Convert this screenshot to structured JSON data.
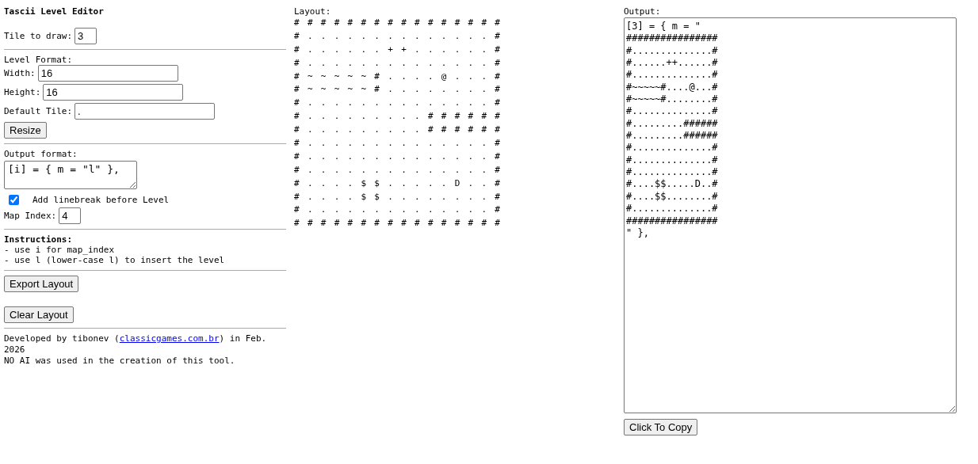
{
  "title": "Tascii Level Editor",
  "tile_to_draw": {
    "label": "Tile to draw:",
    "value": "3"
  },
  "level_format": {
    "heading": "Level Format:",
    "width": {
      "label": "Width:",
      "value": "16"
    },
    "height": {
      "label": "Height:",
      "value": "16"
    },
    "default_tile": {
      "label": "Default Tile:",
      "value": "."
    },
    "button": "Resize"
  },
  "output_format": {
    "heading": "Output format:",
    "value": "[i] = { m = \"l\" },",
    "linebreak": {
      "label": "Add linebreak before Level",
      "checked": true
    },
    "map_index": {
      "label": "Map Index:",
      "value": "4"
    }
  },
  "instructions": {
    "heading": "Instructions:",
    "lines": [
      "- use i for map_index",
      "- use l (lower-case l) to insert the level"
    ]
  },
  "buttons": [
    "Export Layout",
    "Clear Layout"
  ],
  "footer": {
    "before": "Developed by tibonev (",
    "link": "classicgames.com.br",
    "after": ") in Feb. 2026",
    "note": "NO AI was used in the creation of this tool."
  },
  "layout": {
    "label": "Layout:",
    "rows": [
      [
        "#",
        "#",
        "#",
        "#",
        "#",
        "#",
        "#",
        "#",
        "#",
        "#",
        "#",
        "#",
        "#",
        "#",
        "#",
        "#"
      ],
      [
        "#",
        ".",
        ".",
        ".",
        ".",
        ".",
        ".",
        ".",
        ".",
        ".",
        ".",
        ".",
        ".",
        ".",
        ".",
        "#"
      ],
      [
        "#",
        ".",
        ".",
        ".",
        ".",
        ".",
        ".",
        "+",
        "+",
        ".",
        ".",
        ".",
        ".",
        ".",
        ".",
        "#"
      ],
      [
        "#",
        ".",
        ".",
        ".",
        ".",
        ".",
        ".",
        ".",
        ".",
        ".",
        ".",
        ".",
        ".",
        ".",
        ".",
        "#"
      ],
      [
        "#",
        "~",
        "~",
        "~",
        "~",
        "~",
        "#",
        ".",
        ".",
        ".",
        ".",
        "@",
        ".",
        ".",
        ".",
        "#"
      ],
      [
        "#",
        "~",
        "~",
        "~",
        "~",
        "~",
        "#",
        ".",
        ".",
        ".",
        ".",
        ".",
        ".",
        ".",
        ".",
        "#"
      ],
      [
        "#",
        ".",
        ".",
        ".",
        ".",
        ".",
        ".",
        ".",
        ".",
        ".",
        ".",
        ".",
        ".",
        ".",
        ".",
        "#"
      ],
      [
        "#",
        ".",
        ".",
        ".",
        ".",
        ".",
        ".",
        ".",
        ".",
        ".",
        "#",
        "#",
        "#",
        "#",
        "#",
        "#"
      ],
      [
        "#",
        ".",
        ".",
        ".",
        ".",
        ".",
        ".",
        ".",
        ".",
        ".",
        "#",
        "#",
        "#",
        "#",
        "#",
        "#"
      ],
      [
        "#",
        ".",
        ".",
        ".",
        ".",
        ".",
        ".",
        ".",
        ".",
        ".",
        ".",
        ".",
        ".",
        ".",
        ".",
        "#"
      ],
      [
        "#",
        ".",
        ".",
        ".",
        ".",
        ".",
        ".",
        ".",
        ".",
        ".",
        ".",
        ".",
        ".",
        ".",
        ".",
        "#"
      ],
      [
        "#",
        ".",
        ".",
        ".",
        ".",
        ".",
        ".",
        ".",
        ".",
        ".",
        ".",
        ".",
        ".",
        ".",
        ".",
        "#"
      ],
      [
        "#",
        ".",
        ".",
        ".",
        ".",
        "$",
        "$",
        ".",
        ".",
        ".",
        ".",
        ".",
        "D",
        ".",
        ".",
        "#"
      ],
      [
        "#",
        ".",
        ".",
        ".",
        ".",
        "$",
        "$",
        ".",
        ".",
        ".",
        ".",
        ".",
        ".",
        ".",
        ".",
        "#"
      ],
      [
        "#",
        ".",
        ".",
        ".",
        ".",
        ".",
        ".",
        ".",
        ".",
        ".",
        ".",
        ".",
        ".",
        ".",
        ".",
        "#"
      ],
      [
        "#",
        "#",
        "#",
        "#",
        "#",
        "#",
        "#",
        "#",
        "#",
        "#",
        "#",
        "#",
        "#",
        "#",
        "#",
        "#"
      ]
    ]
  },
  "output": {
    "label": "Output:",
    "value": "[3] = { m = \"\n################\n#..............#\n#......++......#\n#..............#\n#~~~~~#....@...#\n#~~~~~#........#\n#..............#\n#.........######\n#.........######\n#..............#\n#..............#\n#..............#\n#....$$.....D..#\n#....$$........#\n#..............#\n################\n\" },",
    "copy_button": "Click To Copy"
  }
}
